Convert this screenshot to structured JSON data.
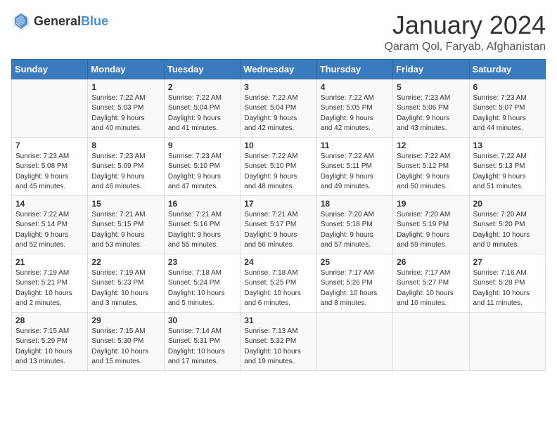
{
  "logo": {
    "text_general": "General",
    "text_blue": "Blue"
  },
  "header": {
    "month_year": "January 2024",
    "location": "Qaram Qol, Faryab, Afghanistan"
  },
  "weekdays": [
    "Sunday",
    "Monday",
    "Tuesday",
    "Wednesday",
    "Thursday",
    "Friday",
    "Saturday"
  ],
  "weeks": [
    [
      {
        "day": "",
        "sunrise": "",
        "sunset": "",
        "daylight": ""
      },
      {
        "day": "1",
        "sunrise": "Sunrise: 7:22 AM",
        "sunset": "Sunset: 5:03 PM",
        "daylight": "Daylight: 9 hours and 40 minutes."
      },
      {
        "day": "2",
        "sunrise": "Sunrise: 7:22 AM",
        "sunset": "Sunset: 5:04 PM",
        "daylight": "Daylight: 9 hours and 41 minutes."
      },
      {
        "day": "3",
        "sunrise": "Sunrise: 7:22 AM",
        "sunset": "Sunset: 5:04 PM",
        "daylight": "Daylight: 9 hours and 42 minutes."
      },
      {
        "day": "4",
        "sunrise": "Sunrise: 7:22 AM",
        "sunset": "Sunset: 5:05 PM",
        "daylight": "Daylight: 9 hours and 42 minutes."
      },
      {
        "day": "5",
        "sunrise": "Sunrise: 7:23 AM",
        "sunset": "Sunset: 5:06 PM",
        "daylight": "Daylight: 9 hours and 43 minutes."
      },
      {
        "day": "6",
        "sunrise": "Sunrise: 7:23 AM",
        "sunset": "Sunset: 5:07 PM",
        "daylight": "Daylight: 9 hours and 44 minutes."
      }
    ],
    [
      {
        "day": "7",
        "sunrise": "Sunrise: 7:23 AM",
        "sunset": "Sunset: 5:08 PM",
        "daylight": "Daylight: 9 hours and 45 minutes."
      },
      {
        "day": "8",
        "sunrise": "Sunrise: 7:23 AM",
        "sunset": "Sunset: 5:09 PM",
        "daylight": "Daylight: 9 hours and 46 minutes."
      },
      {
        "day": "9",
        "sunrise": "Sunrise: 7:23 AM",
        "sunset": "Sunset: 5:10 PM",
        "daylight": "Daylight: 9 hours and 47 minutes."
      },
      {
        "day": "10",
        "sunrise": "Sunrise: 7:22 AM",
        "sunset": "Sunset: 5:10 PM",
        "daylight": "Daylight: 9 hours and 48 minutes."
      },
      {
        "day": "11",
        "sunrise": "Sunrise: 7:22 AM",
        "sunset": "Sunset: 5:11 PM",
        "daylight": "Daylight: 9 hours and 49 minutes."
      },
      {
        "day": "12",
        "sunrise": "Sunrise: 7:22 AM",
        "sunset": "Sunset: 5:12 PM",
        "daylight": "Daylight: 9 hours and 50 minutes."
      },
      {
        "day": "13",
        "sunrise": "Sunrise: 7:22 AM",
        "sunset": "Sunset: 5:13 PM",
        "daylight": "Daylight: 9 hours and 51 minutes."
      }
    ],
    [
      {
        "day": "14",
        "sunrise": "Sunrise: 7:22 AM",
        "sunset": "Sunset: 5:14 PM",
        "daylight": "Daylight: 9 hours and 52 minutes."
      },
      {
        "day": "15",
        "sunrise": "Sunrise: 7:21 AM",
        "sunset": "Sunset: 5:15 PM",
        "daylight": "Daylight: 9 hours and 53 minutes."
      },
      {
        "day": "16",
        "sunrise": "Sunrise: 7:21 AM",
        "sunset": "Sunset: 5:16 PM",
        "daylight": "Daylight: 9 hours and 55 minutes."
      },
      {
        "day": "17",
        "sunrise": "Sunrise: 7:21 AM",
        "sunset": "Sunset: 5:17 PM",
        "daylight": "Daylight: 9 hours and 56 minutes."
      },
      {
        "day": "18",
        "sunrise": "Sunrise: 7:20 AM",
        "sunset": "Sunset: 5:18 PM",
        "daylight": "Daylight: 9 hours and 57 minutes."
      },
      {
        "day": "19",
        "sunrise": "Sunrise: 7:20 AM",
        "sunset": "Sunset: 5:19 PM",
        "daylight": "Daylight: 9 hours and 59 minutes."
      },
      {
        "day": "20",
        "sunrise": "Sunrise: 7:20 AM",
        "sunset": "Sunset: 5:20 PM",
        "daylight": "Daylight: 10 hours and 0 minutes."
      }
    ],
    [
      {
        "day": "21",
        "sunrise": "Sunrise: 7:19 AM",
        "sunset": "Sunset: 5:21 PM",
        "daylight": "Daylight: 10 hours and 2 minutes."
      },
      {
        "day": "22",
        "sunrise": "Sunrise: 7:19 AM",
        "sunset": "Sunset: 5:23 PM",
        "daylight": "Daylight: 10 hours and 3 minutes."
      },
      {
        "day": "23",
        "sunrise": "Sunrise: 7:18 AM",
        "sunset": "Sunset: 5:24 PM",
        "daylight": "Daylight: 10 hours and 5 minutes."
      },
      {
        "day": "24",
        "sunrise": "Sunrise: 7:18 AM",
        "sunset": "Sunset: 5:25 PM",
        "daylight": "Daylight: 10 hours and 6 minutes."
      },
      {
        "day": "25",
        "sunrise": "Sunrise: 7:17 AM",
        "sunset": "Sunset: 5:26 PM",
        "daylight": "Daylight: 10 hours and 8 minutes."
      },
      {
        "day": "26",
        "sunrise": "Sunrise: 7:17 AM",
        "sunset": "Sunset: 5:27 PM",
        "daylight": "Daylight: 10 hours and 10 minutes."
      },
      {
        "day": "27",
        "sunrise": "Sunrise: 7:16 AM",
        "sunset": "Sunset: 5:28 PM",
        "daylight": "Daylight: 10 hours and 11 minutes."
      }
    ],
    [
      {
        "day": "28",
        "sunrise": "Sunrise: 7:15 AM",
        "sunset": "Sunset: 5:29 PM",
        "daylight": "Daylight: 10 hours and 13 minutes."
      },
      {
        "day": "29",
        "sunrise": "Sunrise: 7:15 AM",
        "sunset": "Sunset: 5:30 PM",
        "daylight": "Daylight: 10 hours and 15 minutes."
      },
      {
        "day": "30",
        "sunrise": "Sunrise: 7:14 AM",
        "sunset": "Sunset: 5:31 PM",
        "daylight": "Daylight: 10 hours and 17 minutes."
      },
      {
        "day": "31",
        "sunrise": "Sunrise: 7:13 AM",
        "sunset": "Sunset: 5:32 PM",
        "daylight": "Daylight: 10 hours and 19 minutes."
      },
      {
        "day": "",
        "sunrise": "",
        "sunset": "",
        "daylight": ""
      },
      {
        "day": "",
        "sunrise": "",
        "sunset": "",
        "daylight": ""
      },
      {
        "day": "",
        "sunrise": "",
        "sunset": "",
        "daylight": ""
      }
    ]
  ]
}
